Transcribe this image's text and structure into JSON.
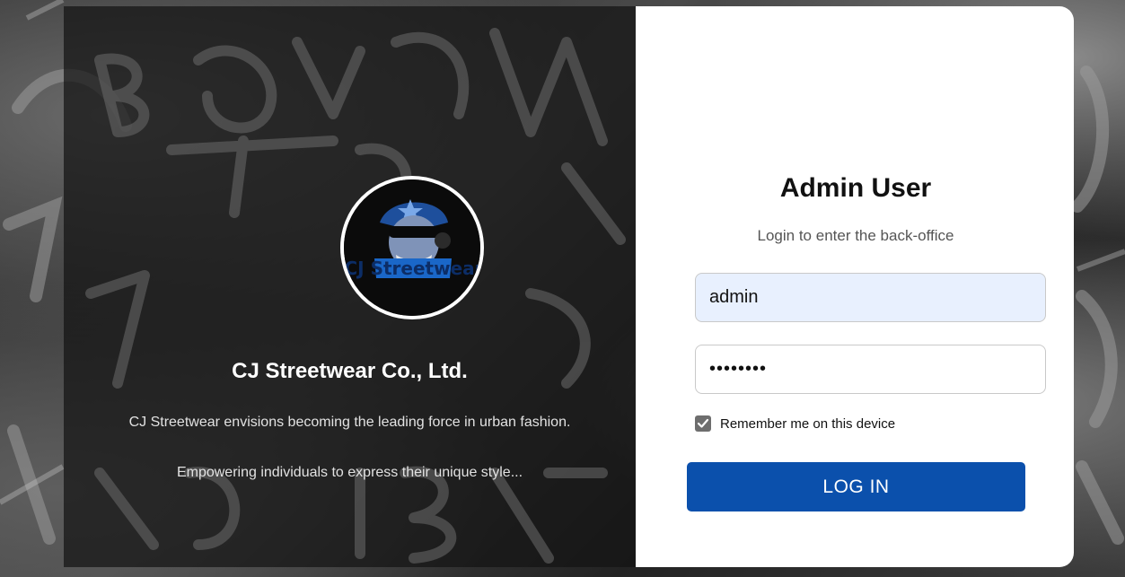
{
  "left": {
    "company_name": "CJ Streetwear Co., Ltd.",
    "tagline_1": "CJ Streetwear envisions becoming the leading force in urban fashion.",
    "tagline_2": "Empowering individuals to express their unique style...",
    "logo": {
      "icon": "cj-streetwear-logo",
      "lettering": "CJ Streetwear"
    }
  },
  "login": {
    "title": "Admin User",
    "subtitle": "Login to enter the back-office",
    "username_value": "admin",
    "password_value": "••••••••",
    "remember_label": "Remember me on this device",
    "remember_checked": true,
    "button_label": "LOG IN"
  },
  "colors": {
    "accent": "#0b50ac",
    "autofill": "#e8f0fe",
    "checkbox": "#6e6e6e"
  }
}
